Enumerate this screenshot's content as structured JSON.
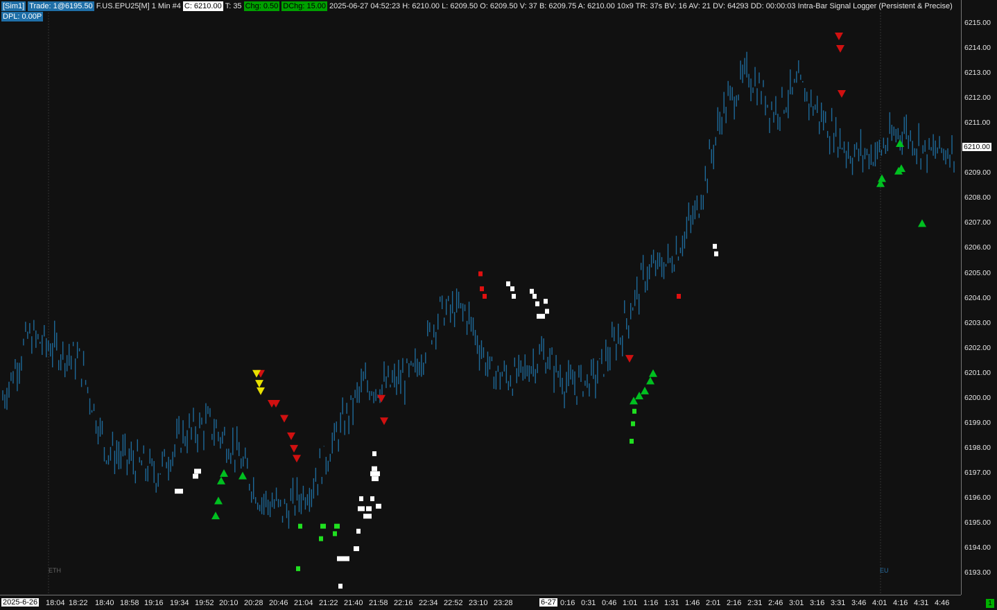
{
  "header": {
    "account": "[Sim1]",
    "trade": "Trade: 1@6195.50",
    "symbol": "F.US.EPU25[M]",
    "interval": "1 Min",
    "bar_number": "#4",
    "close": "C: 6210.00",
    "ticks": "T: 35",
    "change": "Chg: 0.50",
    "daily_change": "DChg: 15.00",
    "details": "2025-06-27 04:52:23 H: 6210.00 L: 6209.50 O: 6209.50 V: 37 B: 6209.75 A: 6210.00 10x9 TR: 37s BV: 16 AV: 21 DV: 64293 DD: 00:00:03 Intra-Bar Signal Logger (Persistent & Precise)",
    "dpl": "DPL: 0.00P"
  },
  "price_axis": {
    "labels": [
      "6215.00",
      "6214.00",
      "6213.00",
      "6212.00",
      "6211.00",
      "6210.00",
      "6209.00",
      "6208.00",
      "6207.00",
      "6206.00",
      "6205.00",
      "6204.00",
      "6203.00",
      "6202.00",
      "6201.00",
      "6200.00",
      "6199.00",
      "6198.00",
      "6197.00",
      "6196.00",
      "6195.00",
      "6194.00",
      "6193.00"
    ],
    "current": "6210.00"
  },
  "time_axis": {
    "start_date": "2025-6-26",
    "labels": [
      "18:04",
      "18:22",
      "18:40",
      "18:58",
      "19:16",
      "19:34",
      "19:52",
      "20:10",
      "20:28",
      "20:46",
      "21:04",
      "21:22",
      "21:40",
      "21:58",
      "22:16",
      "22:34",
      "22:52",
      "23:10",
      "23:28",
      "0:16",
      "0:31",
      "0:46",
      "1:01",
      "1:16",
      "1:31",
      "1:46",
      "2:01",
      "2:16",
      "2:31",
      "2:46",
      "3:01",
      "3:16",
      "3:31",
      "3:46",
      "4:01",
      "4:16",
      "4:31",
      "4:46"
    ],
    "date_marker": "6-27"
  },
  "sessions": {
    "eth": "ETH",
    "eu": "EU"
  },
  "badge": "1",
  "colors": {
    "background": "#111111",
    "price_bar": "#1e6a9a",
    "buy_arrow": "#00c020",
    "sell_arrow": "#d01010",
    "warn_arrow": "#e8e000",
    "white_marker": "#ffffff",
    "green_marker": "#20e020",
    "red_marker": "#e01010"
  },
  "chart_data": {
    "type": "line",
    "title": "F.US.EPU25[M] 1 Min",
    "xlabel": "",
    "ylabel": "",
    "ylim": [
      6192.5,
      6215.5
    ],
    "grid": false,
    "series": [
      {
        "name": "",
        "x": [
          "18:04",
          "18:22",
          "18:40",
          "18:58",
          "19:16",
          "19:34",
          "19:52",
          "20:10",
          "20:28",
          "20:46",
          "21:04",
          "21:22",
          "21:40",
          "21:58",
          "22:16",
          "22:34",
          "22:52",
          "23:10",
          "23:28",
          "0:16",
          "0:31",
          "0:46",
          "1:01",
          "1:16",
          "1:31",
          "1:46",
          "2:01",
          "2:16",
          "2:31",
          "2:46",
          "3:01",
          "3:16",
          "3:31",
          "3:46",
          "4:01",
          "4:16",
          "4:31",
          "4:46"
        ],
        "values": [
          6200.0,
          6202.5,
          6202.0,
          6201.5,
          6198.0,
          6197.5,
          6197.0,
          6198.5,
          6199.0,
          6198.0,
          6196.0,
          6195.5,
          6196.5,
          6198.5,
          6200.5,
          6200.5,
          6201.0,
          6203.5,
          6203.5,
          6201.0,
          6200.8,
          6201.8,
          6200.5,
          6200.8,
          6202.5,
          6205.0,
          6205.5,
          6207.5,
          6211.5,
          6213.0,
          6211.5,
          6212.5,
          6211.0,
          6209.8,
          6209.8,
          6210.8,
          6209.8,
          6210.0
        ]
      }
    ],
    "signals": {
      "buy": [
        6195.3,
        6195.9,
        6196.7,
        6197.0,
        6196.9,
        6199.9,
        6200.1,
        6200.3,
        6200.7,
        6201.0,
        6208.6,
        6208.8,
        6209.1,
        6209.2,
        6210.2,
        6207.0
      ],
      "sell": [
        6201.0,
        6199.8,
        6199.8,
        6199.2,
        6198.5,
        6198.0,
        6197.6,
        6200.0,
        6199.1,
        6201.6,
        6214.5,
        6214.0,
        6212.2
      ],
      "warn": [
        6201.0,
        6200.6,
        6200.3
      ]
    }
  }
}
